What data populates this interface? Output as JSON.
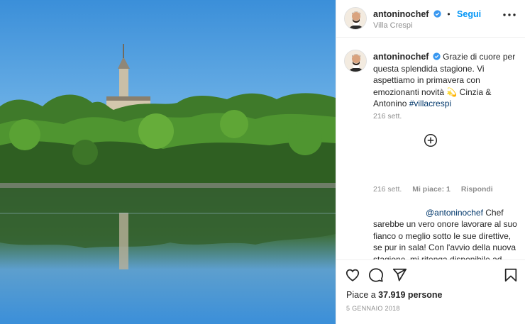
{
  "post": {
    "username": "antoninochef",
    "follow_label": "Segui",
    "location": "Villa Crespi",
    "caption_text": "Grazie di cuore per questa splendida stagione. Vi aspettiamo in primavera con emozionanti novità 💫 Cinzia & Antonino ",
    "caption_hashtag": "#villacrespi",
    "caption_time": "216 sett.",
    "likes_prefix": "Piace a ",
    "likes_count": "37.919 persone",
    "date": "5 GENNAIO 2018"
  },
  "reply": {
    "time": "216 sett.",
    "likes_label": "Mi piace: 1",
    "reply_label": "Rispondi",
    "mention": "@antoninochef",
    "first_line_rest": " Chef",
    "body": "sarebbe un vero onore lavorare al suo fianco o meglio sotto le sue direttive, se pur in sala! Con l'avvio della nuova stagione, mi ritenga disponibile ad"
  },
  "icons": {
    "more": "more-horizontal-icon",
    "verified": "verified-badge-icon",
    "load_more": "plus-circle-icon",
    "like": "heart-icon",
    "comment": "comment-icon",
    "share": "paper-plane-icon",
    "save": "bookmark-icon"
  },
  "colors": {
    "link_blue": "#0095f6",
    "hashtag": "#00376b",
    "muted": "#8e8e8e",
    "text": "#262626"
  }
}
